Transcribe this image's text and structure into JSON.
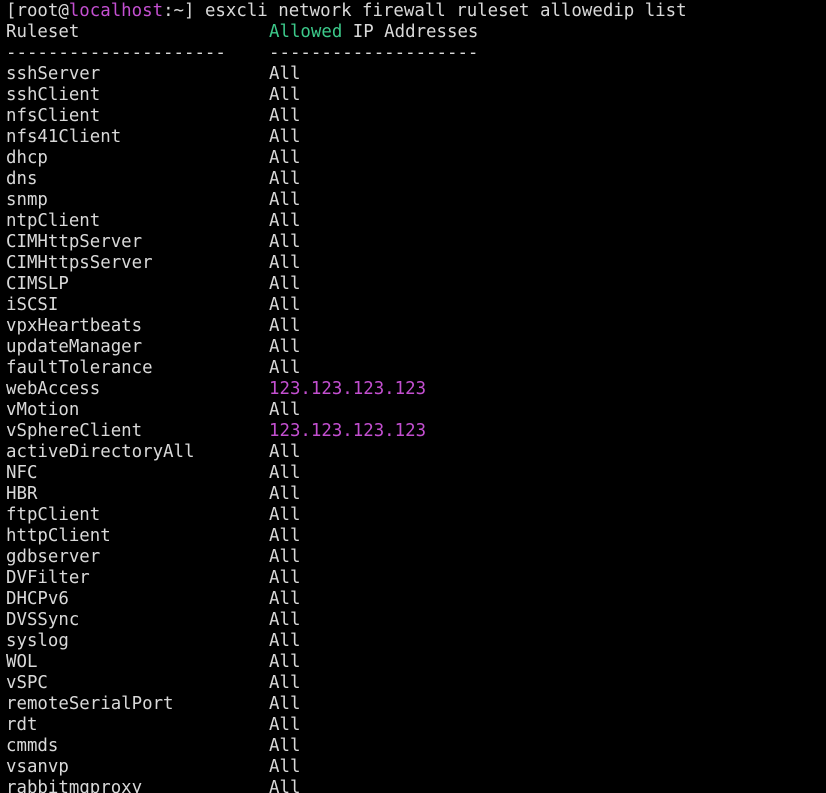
{
  "terminal": {
    "prompt": {
      "prefix": "[root@",
      "host": "localhost",
      "suffix": ":~] ",
      "command": "esxcli network firewall ruleset allowedip list"
    },
    "header": {
      "col1": "Ruleset",
      "col2_highlight": "Allowed",
      "col2_rest": " IP Addresses",
      "sep1": "---------------------",
      "sep2": "--------------------"
    },
    "rows": [
      {
        "ruleset": "sshServer",
        "allowed": "All",
        "highlight": false
      },
      {
        "ruleset": "sshClient",
        "allowed": "All",
        "highlight": false
      },
      {
        "ruleset": "nfsClient",
        "allowed": "All",
        "highlight": false
      },
      {
        "ruleset": "nfs41Client",
        "allowed": "All",
        "highlight": false
      },
      {
        "ruleset": "dhcp",
        "allowed": "All",
        "highlight": false
      },
      {
        "ruleset": "dns",
        "allowed": "All",
        "highlight": false
      },
      {
        "ruleset": "snmp",
        "allowed": "All",
        "highlight": false
      },
      {
        "ruleset": "ntpClient",
        "allowed": "All",
        "highlight": false
      },
      {
        "ruleset": "CIMHttpServer",
        "allowed": "All",
        "highlight": false
      },
      {
        "ruleset": "CIMHttpsServer",
        "allowed": "All",
        "highlight": false
      },
      {
        "ruleset": "CIMSLP",
        "allowed": "All",
        "highlight": false
      },
      {
        "ruleset": "iSCSI",
        "allowed": "All",
        "highlight": false
      },
      {
        "ruleset": "vpxHeartbeats",
        "allowed": "All",
        "highlight": false
      },
      {
        "ruleset": "updateManager",
        "allowed": "All",
        "highlight": false
      },
      {
        "ruleset": "faultTolerance",
        "allowed": "All",
        "highlight": false
      },
      {
        "ruleset": "webAccess",
        "allowed": "123.123.123.123",
        "highlight": true
      },
      {
        "ruleset": "vMotion",
        "allowed": "All",
        "highlight": false
      },
      {
        "ruleset": "vSphereClient",
        "allowed": "123.123.123.123",
        "highlight": true
      },
      {
        "ruleset": "activeDirectoryAll",
        "allowed": "All",
        "highlight": false
      },
      {
        "ruleset": "NFC",
        "allowed": "All",
        "highlight": false
      },
      {
        "ruleset": "HBR",
        "allowed": "All",
        "highlight": false
      },
      {
        "ruleset": "ftpClient",
        "allowed": "All",
        "highlight": false
      },
      {
        "ruleset": "httpClient",
        "allowed": "All",
        "highlight": false
      },
      {
        "ruleset": "gdbserver",
        "allowed": "All",
        "highlight": false
      },
      {
        "ruleset": "DVFilter",
        "allowed": "All",
        "highlight": false
      },
      {
        "ruleset": "DHCPv6",
        "allowed": "All",
        "highlight": false
      },
      {
        "ruleset": "DVSSync",
        "allowed": "All",
        "highlight": false
      },
      {
        "ruleset": "syslog",
        "allowed": "All",
        "highlight": false
      },
      {
        "ruleset": "WOL",
        "allowed": "All",
        "highlight": false
      },
      {
        "ruleset": "vSPC",
        "allowed": "All",
        "highlight": false
      },
      {
        "ruleset": "remoteSerialPort",
        "allowed": "All",
        "highlight": false
      },
      {
        "ruleset": "rdt",
        "allowed": "All",
        "highlight": false
      },
      {
        "ruleset": "cmmds",
        "allowed": "All",
        "highlight": false
      },
      {
        "ruleset": "vsanvp",
        "allowed": "All",
        "highlight": false
      },
      {
        "ruleset": "rabbitmqproxy",
        "allowed": "All",
        "highlight": false
      }
    ]
  },
  "colors": {
    "background": "#000000",
    "text": "#d9d9d9",
    "host": "#c34fd0",
    "header_highlight": "#3cc98a",
    "ip_highlight": "#c34fd0"
  }
}
